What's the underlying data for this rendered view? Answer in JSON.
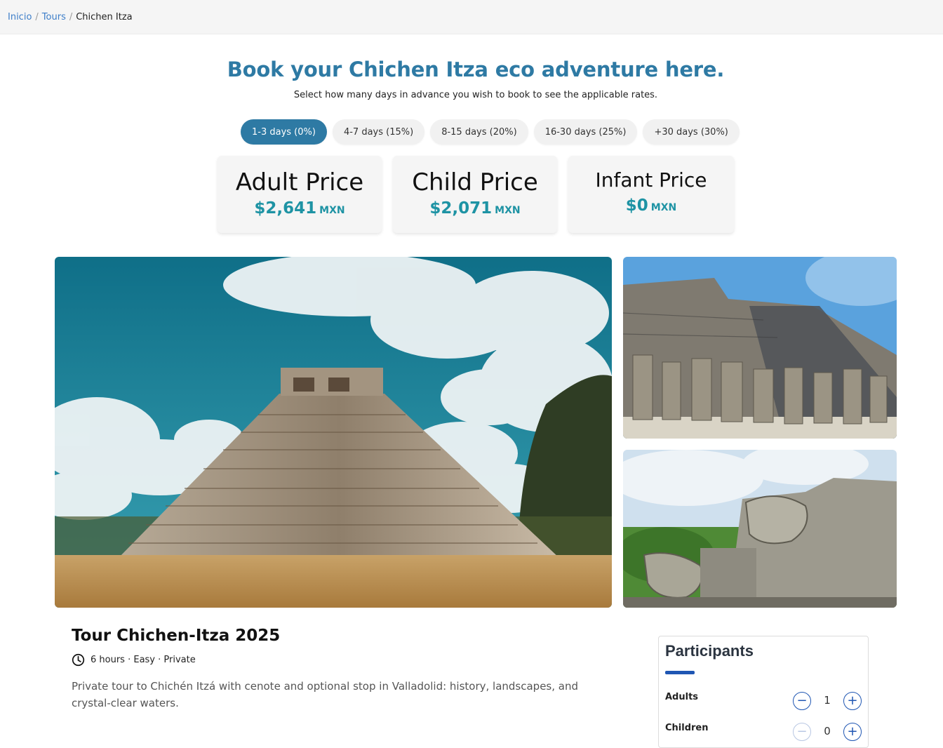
{
  "breadcrumb": {
    "home": "Inicio",
    "tours": "Tours",
    "current": "Chichen Itza"
  },
  "hero": {
    "title": "Book your Chichen Itza eco adventure here.",
    "subtitle": "Select how many days in advance you wish to book to see the applicable rates."
  },
  "advance_options": [
    {
      "label": "1-3 days (0%)",
      "selected": true
    },
    {
      "label": "4-7 days (15%)",
      "selected": false
    },
    {
      "label": "8-15 days (20%)",
      "selected": false
    },
    {
      "label": "16-30 days (25%)",
      "selected": false
    },
    {
      "label": "+30 days (30%)",
      "selected": false
    }
  ],
  "prices": {
    "adult": {
      "label": "Adult Price",
      "value": "$2,641",
      "currency": "MXN"
    },
    "child": {
      "label": "Child Price",
      "value": "$2,071",
      "currency": "MXN"
    },
    "infant": {
      "label": "Infant Price",
      "value": "$0",
      "currency": "MXN"
    }
  },
  "tour": {
    "title": "Tour Chichen-Itza 2025",
    "meta": "6 hours · Easy · Private",
    "description": "Private tour to Chichén Itzá with cenote and optional stop in Valladolid: history, landscapes, and crystal-clear waters."
  },
  "participants": {
    "title": "Participants",
    "adults_label": "Adults",
    "adults_count": "1",
    "children_label": "Children",
    "children_count": "0"
  },
  "icons": {
    "meta": "clock-icon",
    "decrement": "minus-icon",
    "increment": "plus-icon"
  },
  "colors": {
    "accent": "#2e7aa4",
    "price": "#1e93a4",
    "stepper": "#1f56b3",
    "link": "#3d7ec9"
  }
}
